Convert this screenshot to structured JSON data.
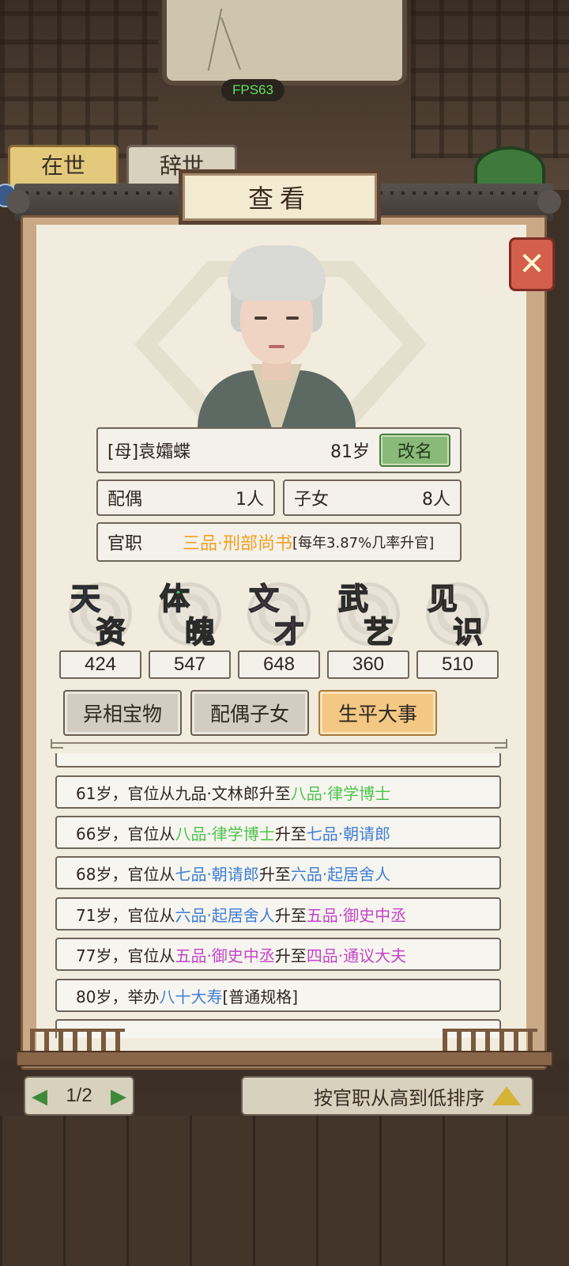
{
  "fps": "FPS63",
  "background": {
    "tabs": [
      "在世",
      "辞世"
    ],
    "pager": {
      "prev": "◀",
      "text": "1/2",
      "next": "▶"
    },
    "sort_label": "按官职从高到低排序"
  },
  "modal": {
    "title": "查看",
    "close_icon": "✕"
  },
  "person": {
    "name": "[母]袁孀蝶",
    "age": "81岁",
    "rename_label": "改名",
    "spouse_label": "配偶",
    "spouse_value": "1人",
    "children_label": "子女",
    "children_value": "8人",
    "office_label": "官职",
    "office_rank": "三品·刑部尚书",
    "office_rate": "[每年3.87%几率升官]"
  },
  "attributes": [
    {
      "c1": "天",
      "c2": "资",
      "value": "424",
      "color": "#3f78e0"
    },
    {
      "c1": "体",
      "c2": "魄",
      "value": "547",
      "color": "#45c46a"
    },
    {
      "c1": "文",
      "c2": "才",
      "value": "648",
      "color": "#c560e0"
    },
    {
      "c1": "武",
      "c2": "艺",
      "value": "360",
      "color": "#ee9a2a"
    },
    {
      "c1": "见",
      "c2": "识",
      "value": "510",
      "color": "#ee6c70"
    }
  ],
  "tabs": [
    "异相宝物",
    "配偶子女",
    "生平大事"
  ],
  "active_tab": "生平大事",
  "events": [
    {
      "a": "61岁，官位从九品·文林郎升至",
      "b": "八品·律学博士"
    },
    {
      "a": "66岁，官位从",
      "b": "八品·律学博士",
      "c": "升至",
      "d": "七品·朝请郎"
    },
    {
      "a": "68岁，官位从",
      "b": "七品·朝请郎",
      "c": "升至",
      "d": "六品·起居舍人"
    },
    {
      "a": "71岁，官位从",
      "b": "六品·起居舍人",
      "c": "升至",
      "d": "五品·御史中丞"
    },
    {
      "a": "77岁，官位从",
      "b": "五品·御史中丞",
      "c": "升至",
      "d": "四品·通议大夫"
    },
    {
      "a": "80岁，举办",
      "b": "八十大寿",
      "c": " [普通规格]"
    }
  ]
}
